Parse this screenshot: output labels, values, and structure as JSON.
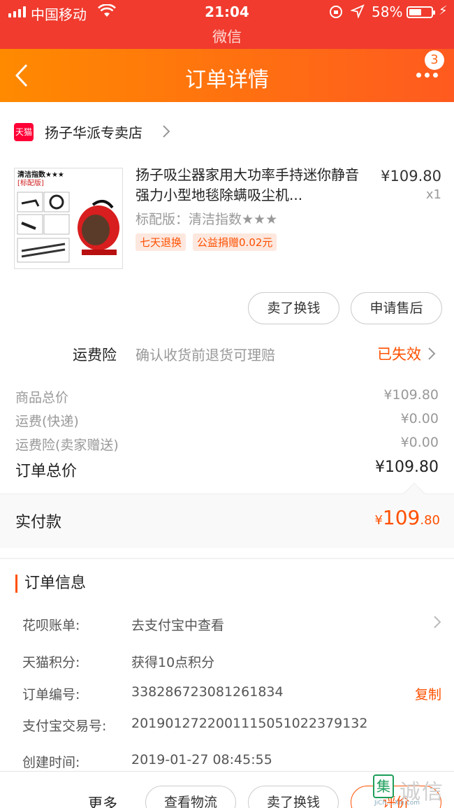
{
  "status_bar": {
    "carrier": "中国移动",
    "time": "21:04",
    "battery": "58%",
    "battery_level": 0.58,
    "sub_app": "微信"
  },
  "header": {
    "title": "订单详情",
    "more_badge": "3"
  },
  "shop": {
    "badge": "天猫",
    "name": "扬子华派专卖店"
  },
  "product": {
    "name": "扬子吸尘器家用大功率手持迷你静音强力小型地毯除螨吸尘机...",
    "price": "¥109.80",
    "qty": "x1",
    "spec": "标配版：清洁指数★★★",
    "tags": [
      "七天退换",
      "公益捐赠0.02元"
    ],
    "img_label_1": "清洁指数★★★",
    "img_label_2": "[标配版]"
  },
  "actions": {
    "sell": "卖了换钱",
    "after_sale": "申请售后"
  },
  "insurance": {
    "label": "运费险",
    "desc": "确认收货前退货可理赔",
    "status": "已失效"
  },
  "summary": {
    "goods_label": "商品总价",
    "goods_value": "¥109.80",
    "shipping_label": "运费(快递)",
    "shipping_value": "¥0.00",
    "ins_label": "运费险(卖家赠送)",
    "ins_value": "¥0.00",
    "total_label": "订单总价",
    "total_value": "¥109.80"
  },
  "payment": {
    "label": "实付款",
    "currency": "¥",
    "int": "109",
    "dec": ".80"
  },
  "order_info": {
    "title": "订单信息",
    "huabei_label": "花呗账单:",
    "huabei_value": "去支付宝中查看",
    "points_label": "天猫积分:",
    "points_value": "获得10点积分",
    "order_no_label": "订单编号:",
    "order_no_value": "338286723081261834",
    "copy": "复制",
    "alipay_label": "支付宝交易号:",
    "alipay_value": "2019012722001115051022379132",
    "created_label": "创建时间:",
    "created_value": "2019-01-27 08:45:55"
  },
  "bottom_bar": {
    "more": "更多",
    "logistics": "查看物流",
    "sell": "卖了换钱",
    "review": "评价"
  },
  "watermark": {
    "char": "集",
    "text": "诚信",
    "url": "JiCh....Xin.com"
  },
  "colors": {
    "status_bg": "#f03b2e",
    "header_from": "#ff8a00",
    "header_to": "#ff5a1f",
    "accent": "#ff5000"
  }
}
